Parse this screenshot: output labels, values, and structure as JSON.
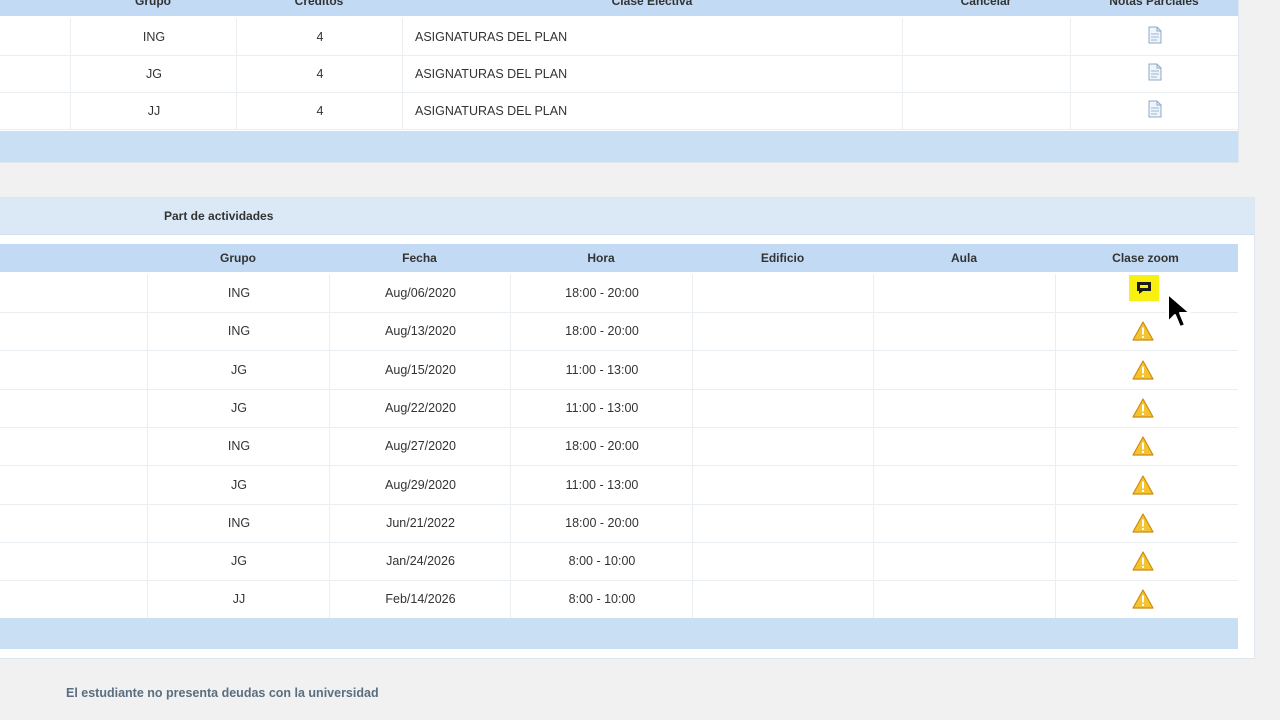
{
  "top_table": {
    "headers": [
      "Grupo",
      "Créditos",
      "Clase Electiva",
      "Cancelar",
      "Notas Parciales"
    ],
    "rows": [
      {
        "grupo": "ING",
        "creditos": "4",
        "clase": "ASIGNATURAS DEL PLAN",
        "icon": "document-icon"
      },
      {
        "grupo": "JG",
        "creditos": "4",
        "clase": "ASIGNATURAS DEL PLAN",
        "icon": "document-icon"
      },
      {
        "grupo": "JJ",
        "creditos": "4",
        "clase": "ASIGNATURAS DEL PLAN",
        "icon": "document-icon"
      }
    ]
  },
  "activities": {
    "title": "Part de actividades",
    "headers": [
      "Grupo",
      "Fecha",
      "Hora",
      "Edificio",
      "Aula",
      "Clase zoom"
    ],
    "rows": [
      {
        "grupo": "ING",
        "fecha": "Aug/06/2020",
        "hora": "18:00 - 20:00",
        "edificio": "",
        "aula": "",
        "icon": "zoom-chat-icon"
      },
      {
        "grupo": "ING",
        "fecha": "Aug/13/2020",
        "hora": "18:00 - 20:00",
        "edificio": "",
        "aula": "",
        "icon": "warning-icon"
      },
      {
        "grupo": "JG",
        "fecha": "Aug/15/2020",
        "hora": "11:00 - 13:00",
        "edificio": "",
        "aula": "",
        "icon": "warning-icon"
      },
      {
        "grupo": "JG",
        "fecha": "Aug/22/2020",
        "hora": "11:00 - 13:00",
        "edificio": "",
        "aula": "",
        "icon": "warning-icon"
      },
      {
        "grupo": "ING",
        "fecha": "Aug/27/2020",
        "hora": "18:00 - 20:00",
        "edificio": "",
        "aula": "",
        "icon": "warning-icon"
      },
      {
        "grupo": "JG",
        "fecha": "Aug/29/2020",
        "hora": "11:00 - 13:00",
        "edificio": "",
        "aula": "",
        "icon": "warning-icon"
      },
      {
        "grupo": "ING",
        "fecha": "Jun/21/2022",
        "hora": "18:00 - 20:00",
        "edificio": "",
        "aula": "",
        "icon": "warning-icon"
      },
      {
        "grupo": "JG",
        "fecha": "Jan/24/2026",
        "hora": "8:00 - 10:00",
        "edificio": "",
        "aula": "",
        "icon": "warning-icon"
      },
      {
        "grupo": "JJ",
        "fecha": "Feb/14/2026",
        "hora": "8:00 - 10:00",
        "edificio": "",
        "aula": "",
        "icon": "warning-icon"
      }
    ]
  },
  "footer_note": "El estudiante no presenta deudas con la universidad",
  "colors": {
    "header_blue": "#c2daf3",
    "band_blue": "#dbe9f7",
    "zoom_highlight": "#f7f010",
    "warning_yellow": "#f4c430",
    "note_text": "#596e80"
  }
}
